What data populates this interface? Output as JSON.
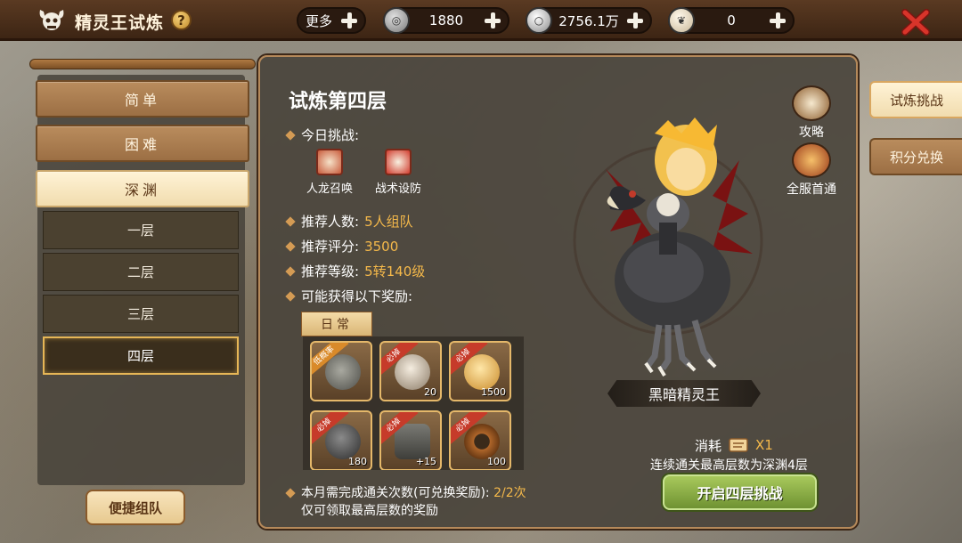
{
  "header": {
    "title": "精灵王试炼",
    "resources": [
      {
        "label": "更多",
        "value": "",
        "icon": "more-icon"
      },
      {
        "label": "",
        "value": "1880",
        "icon": "silver-coin-icon"
      },
      {
        "label": "",
        "value": "2756.1万",
        "icon": "gold-ring-icon"
      },
      {
        "label": "",
        "value": "0",
        "icon": "shell-icon"
      }
    ]
  },
  "sidebar": {
    "difficulties": [
      {
        "label": "简单",
        "active": false
      },
      {
        "label": "困难",
        "active": false
      },
      {
        "label": "深渊",
        "active": true
      }
    ],
    "floors": [
      {
        "label": "一层",
        "active": false
      },
      {
        "label": "二层",
        "active": false
      },
      {
        "label": "三层",
        "active": false
      },
      {
        "label": "四层",
        "active": true
      }
    ],
    "team_button": "便捷组队"
  },
  "main": {
    "floor_title": "试炼第四层",
    "today_challenge_label": "今日挑战:",
    "challenges": [
      {
        "label": "人龙召唤",
        "icon": "dragon-summon-icon"
      },
      {
        "label": "战术设防",
        "icon": "tactical-defense-icon"
      }
    ],
    "recommend": [
      {
        "key": "推荐人数:",
        "value": "5人组队"
      },
      {
        "key": "推荐评分:",
        "value": "3500"
      },
      {
        "key": "推荐等级:",
        "value": "5转140级"
      }
    ],
    "rewards_label": "可能获得以下奖励:",
    "reward_tab": "日常",
    "rewards": [
      {
        "ribbon": "低概率",
        "count": "",
        "icon": "rhino-pet-icon"
      },
      {
        "ribbon": "必掉",
        "count": "20",
        "icon": "horned-skull-icon"
      },
      {
        "ribbon": "必掉",
        "count": "1500",
        "icon": "shell-icon"
      },
      {
        "ribbon": "必掉",
        "count": "180",
        "icon": "skull-coin-icon"
      },
      {
        "ribbon": "必掉",
        "count": "+15",
        "icon": "armor-icon"
      },
      {
        "ribbon": "必掉",
        "count": "100",
        "icon": "gear-icon"
      }
    ],
    "note_line1": "本月需完成通关次数(可兑换奖励):",
    "note_progress": "2/2次",
    "note_line2": "仅可领取最高层数的奖励"
  },
  "boss": {
    "name": "黑暗精灵王",
    "guide_label": "攻略",
    "first_clear_label": "全服首通",
    "cost_label": "消耗",
    "cost_value": "X1",
    "cost_note": "连续通关最高层数为深渊4层",
    "start_button": "开启四层挑战"
  },
  "right_tabs": [
    {
      "label": "试炼挑战",
      "active": true
    },
    {
      "label": "积分兑换",
      "active": false
    }
  ],
  "colors": {
    "accent_gold": "#f5b94a",
    "panel_border": "#b5895a",
    "start_green": "#8fb046",
    "ribbon_red": "#c63b2a"
  }
}
